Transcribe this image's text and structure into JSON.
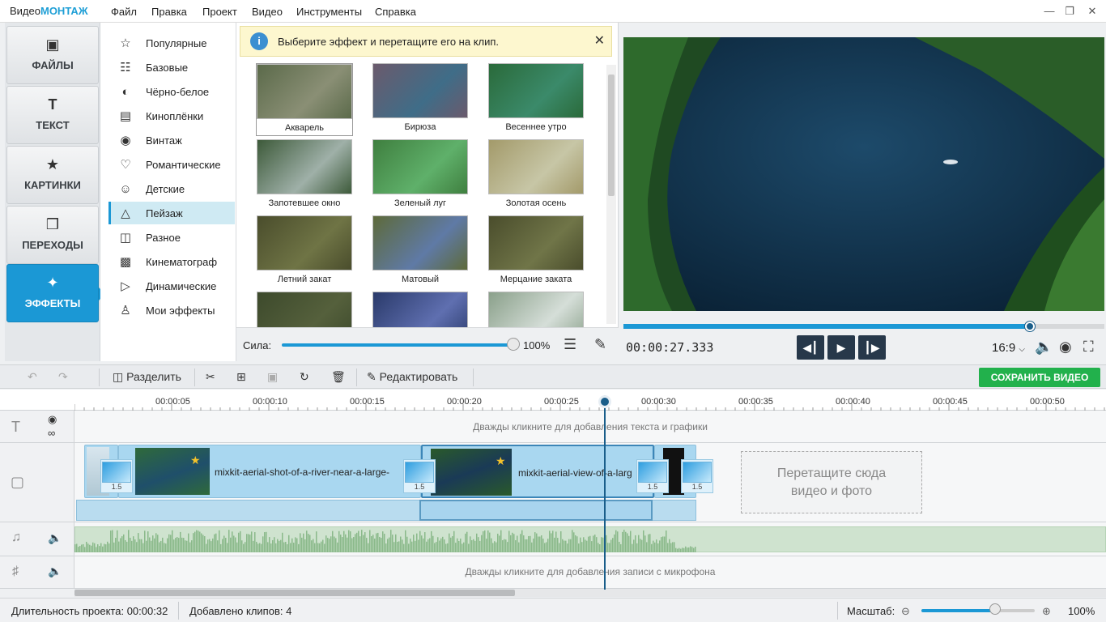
{
  "app": {
    "brand_prefix": "Видео",
    "brand_suffix": "МОНТАЖ"
  },
  "menu": [
    "Файл",
    "Правка",
    "Проект",
    "Видео",
    "Инструменты",
    "Справка"
  ],
  "left_tabs": [
    {
      "label": "ФАЙЛЫ",
      "icon": "image-icon"
    },
    {
      "label": "ТЕКСТ",
      "icon": "text-icon"
    },
    {
      "label": "КАРТИНКИ",
      "icon": "star-icon"
    },
    {
      "label": "ПЕРЕХОДЫ",
      "icon": "transitions-icon"
    },
    {
      "label": "ЭФФЕКТЫ",
      "icon": "magic-wand-icon",
      "active": true
    }
  ],
  "categories": [
    {
      "label": "Популярные",
      "icon": "star-outline-icon"
    },
    {
      "label": "Базовые",
      "icon": "sliders-icon"
    },
    {
      "label": "Чёрно-белое",
      "icon": "contrast-icon"
    },
    {
      "label": "Киноплёнки",
      "icon": "film-icon"
    },
    {
      "label": "Винтаж",
      "icon": "camera-icon"
    },
    {
      "label": "Романтические",
      "icon": "heart-icon"
    },
    {
      "label": "Детские",
      "icon": "kids-icon"
    },
    {
      "label": "Пейзаж",
      "icon": "mountain-icon",
      "active": true
    },
    {
      "label": "Разное",
      "icon": "misc-icon"
    },
    {
      "label": "Кинематограф",
      "icon": "cinema-icon"
    },
    {
      "label": "Динамические",
      "icon": "play-circle-icon"
    },
    {
      "label": "Мои эффекты",
      "icon": "user-icon"
    }
  ],
  "info": {
    "text": "Выберите эффект и перетащите его на клип."
  },
  "effects": [
    {
      "label": "Акварель",
      "colors": [
        "#5b6a4a",
        "#8a8f75"
      ]
    },
    {
      "label": "Бирюза",
      "colors": [
        "#6b5a6c",
        "#3f6d88"
      ]
    },
    {
      "label": "Весеннее утро",
      "colors": [
        "#2a6a3a",
        "#3b8a6a"
      ]
    },
    {
      "label": "Запотевшее окно",
      "colors": [
        "#3d5a3a",
        "#9fb0a8"
      ]
    },
    {
      "label": "Зеленый луг",
      "colors": [
        "#3f7f3f",
        "#5fb06a"
      ]
    },
    {
      "label": "Золотая осень",
      "colors": [
        "#a39a6a",
        "#c7c6a6"
      ]
    },
    {
      "label": "Летний закат",
      "colors": [
        "#4a4d2c",
        "#6f7445"
      ]
    },
    {
      "label": "Матовый",
      "colors": [
        "#5e6a3a",
        "#5f7aa6"
      ]
    },
    {
      "label": "Мерцание заката",
      "colors": [
        "#4a4d2c",
        "#707548"
      ]
    },
    {
      "label": "",
      "colors": [
        "#3d4a2c",
        "#55603c"
      ]
    },
    {
      "label": "",
      "colors": [
        "#2a3a6a",
        "#5f6fb0"
      ]
    },
    {
      "label": "",
      "colors": [
        "#8aa08a",
        "#d5ded8"
      ]
    }
  ],
  "strength": {
    "label": "Сила:",
    "value": "100%",
    "fraction": 1.0
  },
  "player": {
    "timecode": "00:00:27.333",
    "aspect": "16:9",
    "progress": 0.845
  },
  "toolbar": {
    "split": "Разделить",
    "edit": "Редактировать",
    "save": "СОХРАНИТЬ ВИДЕО"
  },
  "ruler": [
    "00:00:05",
    "00:00:10",
    "00:00:15",
    "00:00:20",
    "00:00:25",
    "00:00:30",
    "00:00:35",
    "00:00:40",
    "00:00:45",
    "00:00:50"
  ],
  "tracks": {
    "text_hint": "Дважды кликните для добавления текста и графики",
    "mic_hint": "Дважды кликните для добавления записи с микрофона",
    "drop_line1": "Перетащите сюда",
    "drop_line2": "видео и фото"
  },
  "clips": [
    {
      "name": "mixkit-aerial-shot-of-a-river-near-a-large-"
    },
    {
      "name": "mixkit-aerial-view-of-a-larg"
    }
  ],
  "transition_value": "1.5",
  "status": {
    "duration": "Длительность проекта:  00:00:32",
    "clips": "Добавлено клипов: 4",
    "zoom_label": "Масштаб:",
    "zoom_value": "100%",
    "zoom_fraction": 0.65
  }
}
